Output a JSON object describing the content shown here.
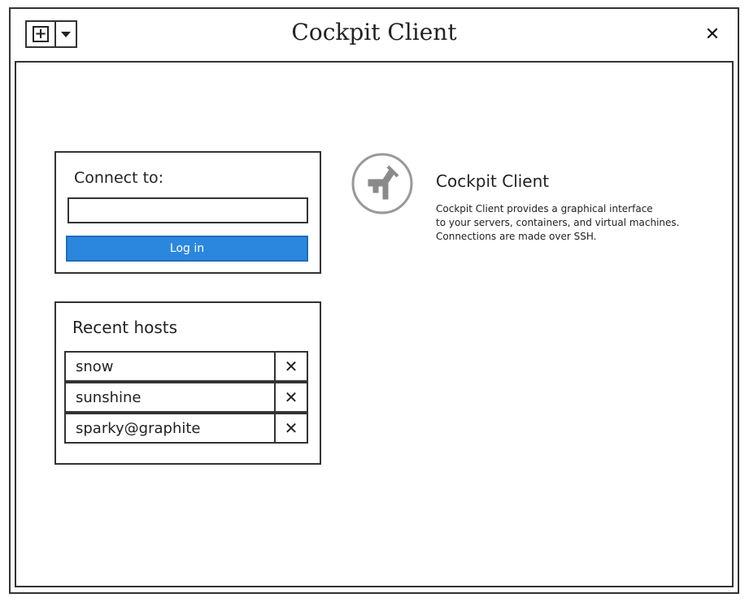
{
  "window": {
    "title": "Cockpit Client",
    "new_icon": "plus-square-icon",
    "dropdown_icon": "triangle-down-icon",
    "close_icon": "close-icon",
    "close_glyph": "✕"
  },
  "connect": {
    "label": "Connect to:",
    "input_value": "",
    "login_label": "Log in",
    "login_color": "#2b87de"
  },
  "recent": {
    "title": "Recent hosts",
    "remove_glyph": "✕",
    "hosts": [
      {
        "name": "snow"
      },
      {
        "name": "sunshine"
      },
      {
        "name": "sparky@graphite"
      }
    ]
  },
  "about": {
    "logo_icon": "cockpit-logo-icon",
    "title": "Cockpit Client",
    "description_lines": [
      "Cockpit Client provides a graphical interface",
      "to your servers, containers, and virtual machines.",
      "Connections are made over SSH."
    ]
  }
}
